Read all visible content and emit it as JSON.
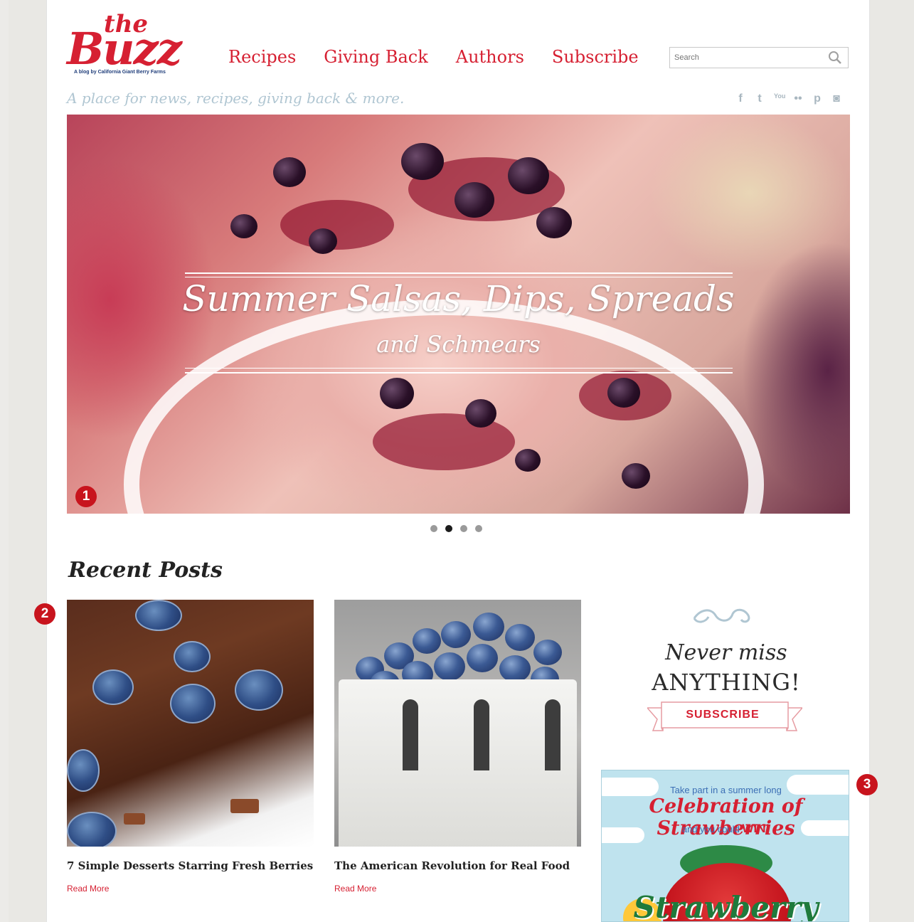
{
  "logo": {
    "the": "the",
    "buzz": "Buzz",
    "tagline": "A blog by California Giant Berry Farms"
  },
  "nav": {
    "items": [
      "Recipes",
      "Giving Back",
      "Authors",
      "Subscribe"
    ]
  },
  "search": {
    "placeholder": "Search"
  },
  "tagline": "A place for news, recipes, giving back & more.",
  "social": [
    "f",
    "t",
    "You",
    "••",
    "p",
    "◙"
  ],
  "hero": {
    "title": "Summer Salsas, Dips, Spreads",
    "subtitle": "and Schmears",
    "slide_count": 4,
    "active_slide": 2
  },
  "callouts": [
    "1",
    "2",
    "3"
  ],
  "recent_posts": {
    "heading": "Recent Posts",
    "posts": [
      {
        "title": "7 Simple Desserts Starring Fresh Berries",
        "link": "Read More"
      },
      {
        "title": "The American Revolution for Real Food",
        "link": "Read More"
      }
    ]
  },
  "sidebar": {
    "never": "Never miss",
    "anything": "ANYTHING!",
    "subscribe_label": "SUBSCRIBE",
    "promo": {
      "line1": "Take part in a summer long",
      "line2": "Celebration of Strawberries",
      "line3_pre": "and you could",
      "line3_win": "WIN!",
      "word": "Strawberry"
    }
  },
  "colors": {
    "brand_red": "#d62032",
    "tagline_blue": "#b0c6d2",
    "callout_red": "#c8141d"
  }
}
